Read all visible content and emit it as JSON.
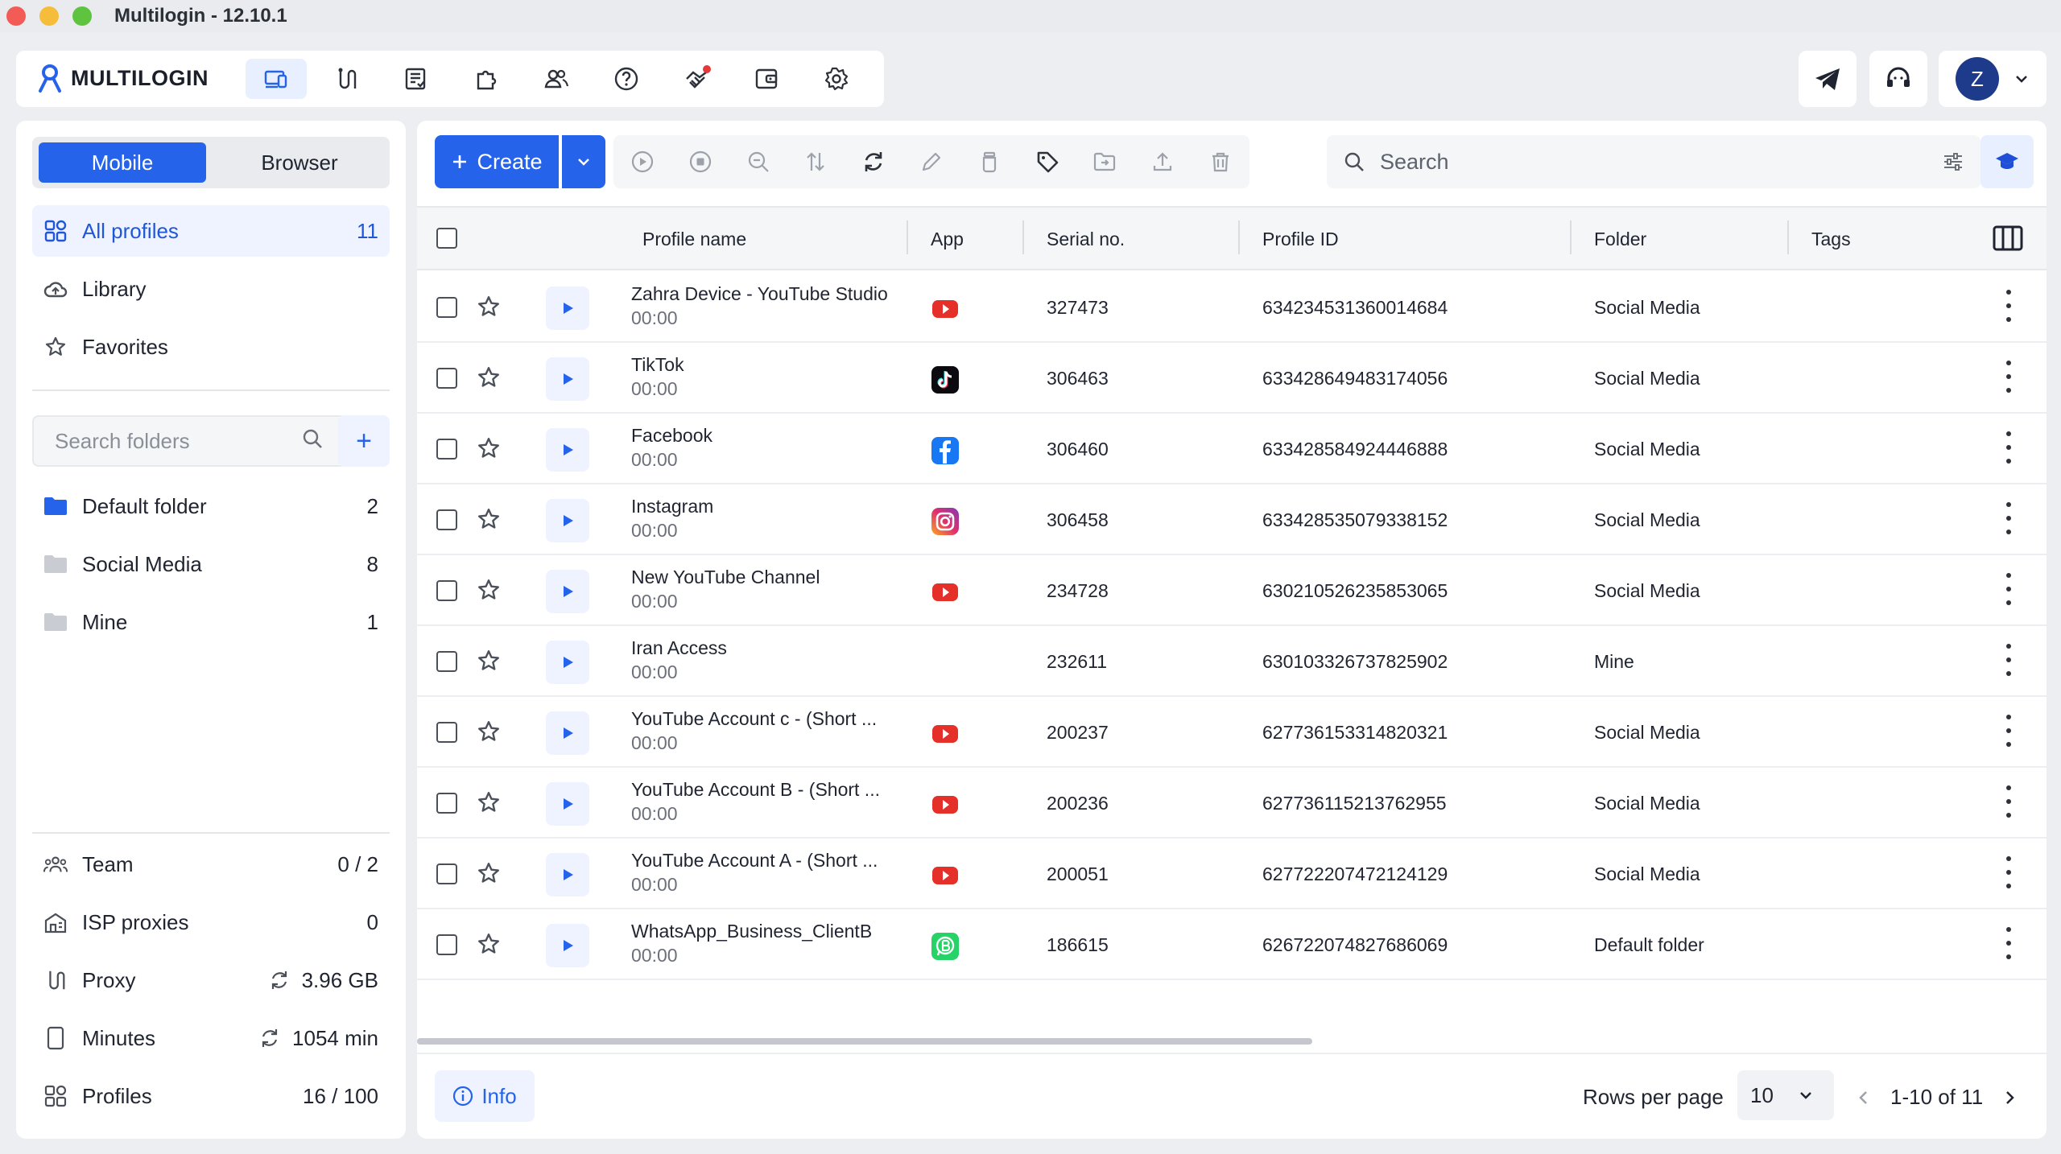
{
  "window": {
    "title": "Multilogin - 12.10.1"
  },
  "brand": {
    "logo_text": "MULTILOGIN",
    "accent": "#2563eb"
  },
  "nav": {
    "icons": [
      "profiles-icon",
      "proxy-icon",
      "scripts-icon",
      "extensions-icon",
      "team-icon",
      "help-icon",
      "affiliate-icon",
      "wallet-icon",
      "settings-icon"
    ]
  },
  "sidebar": {
    "tabs": {
      "mobile": "Mobile",
      "browser": "Browser"
    },
    "items": [
      {
        "label": "All profiles",
        "count": "11"
      },
      {
        "label": "Library",
        "count": ""
      },
      {
        "label": "Favorites",
        "count": ""
      }
    ],
    "search_placeholder": "Search folders",
    "add_label": "+",
    "folders": [
      {
        "label": "Default folder",
        "count": "2"
      },
      {
        "label": "Social Media",
        "count": "8"
      },
      {
        "label": "Mine",
        "count": "1"
      }
    ],
    "stats": [
      {
        "label": "Team",
        "value": "0 / 2"
      },
      {
        "label": "ISP proxies",
        "value": "0"
      },
      {
        "label": "Proxy",
        "value": "3.96 GB"
      },
      {
        "label": "Minutes",
        "value": "1054 min"
      },
      {
        "label": "Profiles",
        "value": "16 / 100"
      }
    ]
  },
  "toolbar": {
    "create_label": "Create",
    "search_placeholder": "Search"
  },
  "table": {
    "headers": {
      "name": "Profile name",
      "app": "App",
      "serial": "Serial no.",
      "pid": "Profile ID",
      "folder": "Folder",
      "tags": "Tags"
    },
    "rows": [
      {
        "name": "Zahra Device - YouTube Studio",
        "time": "00:00",
        "app": "youtube",
        "serial": "327473",
        "pid": "634234531360014684",
        "folder": "Social Media"
      },
      {
        "name": "TikTok",
        "time": "00:00",
        "app": "tiktok",
        "serial": "306463",
        "pid": "633428649483174056",
        "folder": "Social Media"
      },
      {
        "name": "Facebook",
        "time": "00:00",
        "app": "facebook",
        "serial": "306460",
        "pid": "633428584924446888",
        "folder": "Social Media"
      },
      {
        "name": "Instagram",
        "time": "00:00",
        "app": "instagram",
        "serial": "306458",
        "pid": "633428535079338152",
        "folder": "Social Media"
      },
      {
        "name": "New YouTube Channel",
        "time": "00:00",
        "app": "youtube",
        "serial": "234728",
        "pid": "630210526235853065",
        "folder": "Social Media"
      },
      {
        "name": "Iran Access",
        "time": "00:00",
        "app": "",
        "serial": "232611",
        "pid": "630103326737825902",
        "folder": "Mine"
      },
      {
        "name": "YouTube Account c - (Short ...",
        "time": "00:00",
        "app": "youtube",
        "serial": "200237",
        "pid": "627736153314820321",
        "folder": "Social Media"
      },
      {
        "name": "YouTube Account B - (Short ...",
        "time": "00:00",
        "app": "youtube",
        "serial": "200236",
        "pid": "627736115213762955",
        "folder": "Social Media"
      },
      {
        "name": "YouTube Account A - (Short ...",
        "time": "00:00",
        "app": "youtube",
        "serial": "200051",
        "pid": "627722207472124129",
        "folder": "Social Media"
      },
      {
        "name": "WhatsApp_Business_ClientB",
        "time": "00:00",
        "app": "whatsapp-business",
        "serial": "186615",
        "pid": "626722074827686069",
        "folder": "Default folder"
      }
    ]
  },
  "footer": {
    "info_label": "Info",
    "rows_per_page_label": "Rows per page",
    "rows_per_page_value": "10",
    "range": "1-10 of 11"
  },
  "user": {
    "initial": "Z"
  }
}
